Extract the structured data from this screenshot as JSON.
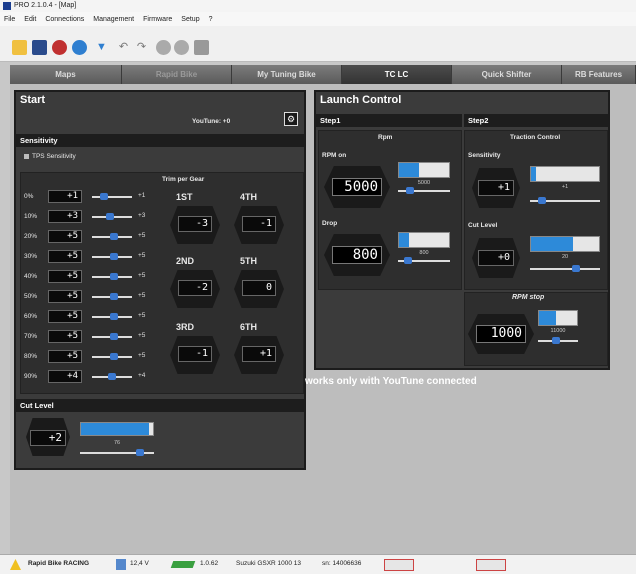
{
  "window": {
    "title": "PRO 2.1.0.4 - [Map]"
  },
  "menu": [
    "File",
    "Edit",
    "Connections",
    "Management",
    "Firmware",
    "Setup",
    "?"
  ],
  "tabs": [
    {
      "label": "Maps",
      "state": "normal"
    },
    {
      "label": "Rapid Bike",
      "state": "dim"
    },
    {
      "label": "My Tuning Bike",
      "state": "normal"
    },
    {
      "label": "TC   LC",
      "state": "active"
    },
    {
      "label": "Quick Shifter",
      "state": "normal"
    },
    {
      "label": "RB Features",
      "state": "normal"
    }
  ],
  "start": {
    "title": "Start",
    "youtune": "YouTune: +0",
    "sensitivity_header": "Sensitivity",
    "tps_label": "TPS Sensitivity",
    "rows": [
      {
        "pct": "0%",
        "value": "+1",
        "slider": "+1",
        "knob": 0.25
      },
      {
        "pct": "10%",
        "value": "+3",
        "slider": "+3",
        "knob": 0.45
      },
      {
        "pct": "20%",
        "value": "+5",
        "slider": "+5",
        "knob": 0.55
      },
      {
        "pct": "30%",
        "value": "+5",
        "slider": "+5",
        "knob": 0.55
      },
      {
        "pct": "40%",
        "value": "+5",
        "slider": "+5",
        "knob": 0.55
      },
      {
        "pct": "50%",
        "value": "+5",
        "slider": "+5",
        "knob": 0.55
      },
      {
        "pct": "60%",
        "value": "+5",
        "slider": "+5",
        "knob": 0.55
      },
      {
        "pct": "70%",
        "value": "+5",
        "slider": "+5",
        "knob": 0.55
      },
      {
        "pct": "80%",
        "value": "+5",
        "slider": "+5",
        "knob": 0.55
      },
      {
        "pct": "90%",
        "value": "+4",
        "slider": "+4",
        "knob": 0.5
      }
    ],
    "trim_title": "Trim per Gear",
    "gears": [
      {
        "label": "1ST",
        "value": "-3"
      },
      {
        "label": "4TH",
        "value": "-1"
      },
      {
        "label": "2ND",
        "value": "-2"
      },
      {
        "label": "5TH",
        "value": "0"
      },
      {
        "label": "3RD",
        "value": "-1"
      },
      {
        "label": "6TH",
        "value": "+1"
      }
    ],
    "cut_level": {
      "title": "Cut Level",
      "value": "+2",
      "bar_caption": "76",
      "fill": 0.94
    }
  },
  "launch": {
    "title": "Launch Control",
    "step1": {
      "header": "Step1",
      "sub": "Rpm",
      "rpm_on": {
        "label": "RPM on",
        "value": "5000",
        "bar_caption": "5000",
        "fill": 0.4
      },
      "drop": {
        "label": "Drop",
        "value": "800",
        "bar_caption": "800",
        "fill": 0.2
      }
    },
    "step2": {
      "header": "Step2",
      "sub": "Traction Control",
      "sensitivity": {
        "label": "Sensitivity",
        "value": "+1",
        "bar_caption": "+1",
        "fill": 0.08
      },
      "cut_level": {
        "label": "Cut Level",
        "value": "+0",
        "bar_caption": "20",
        "fill": 0.62
      }
    },
    "rpm_stop": {
      "label": "RPM stop",
      "value": "1000",
      "bar_caption": "11000",
      "fill": 0.45
    }
  },
  "notice": "works only with YouTune connected",
  "status": {
    "product": "Rapid Bike RACING",
    "voltage": "12,4 V",
    "version": "1.0.62",
    "model": "Suzuki GSXR 1000 13",
    "serial": "sn: 14006636"
  },
  "colors": {
    "accent": "#2d8ad9",
    "panel": "#3b3b3b",
    "header": "#1d1d1d"
  }
}
